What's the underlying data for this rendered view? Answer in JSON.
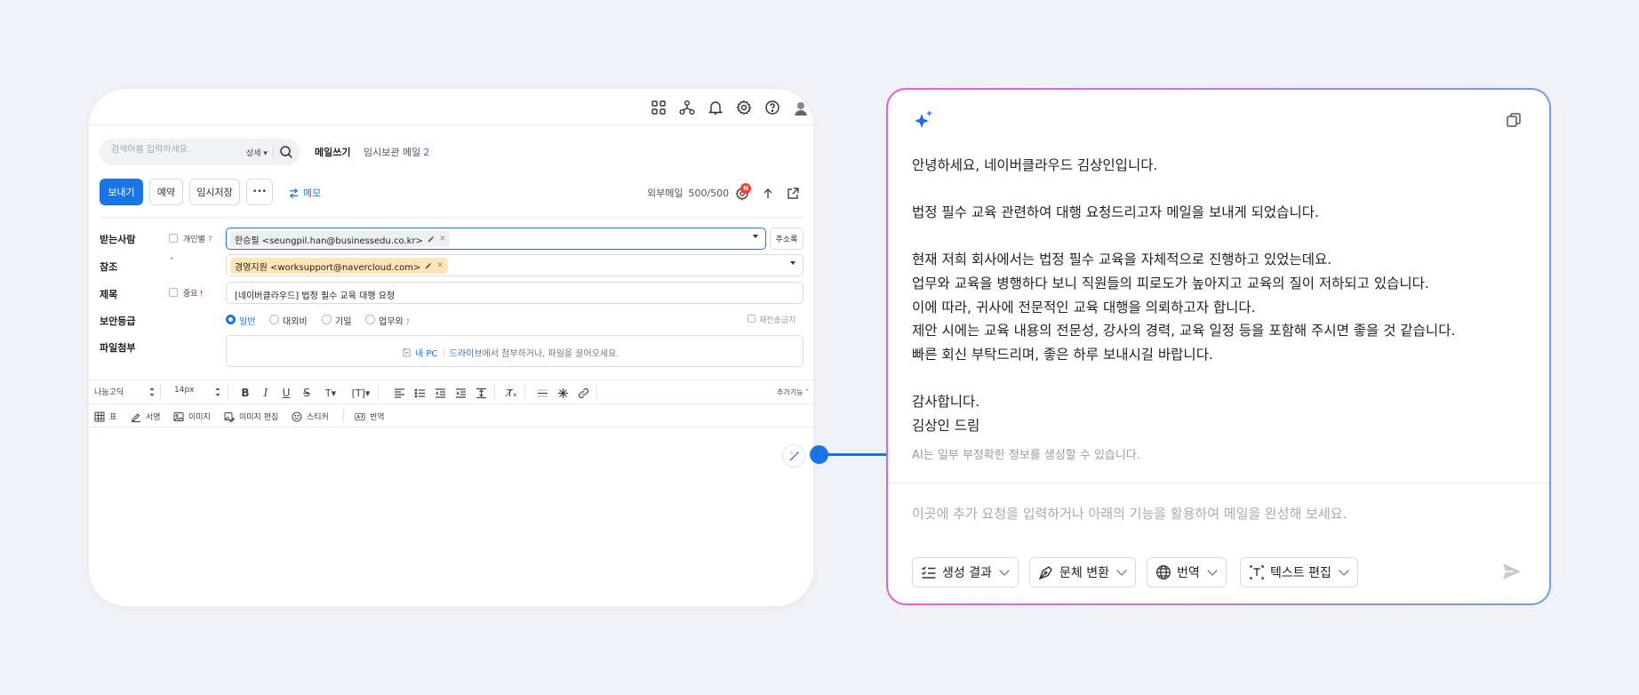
{
  "mail": {
    "search": {
      "placeholder": "검색어를 입력하세요.",
      "detail_label": "상세 ▾"
    },
    "tabs": {
      "compose": "메일쓰기",
      "drafts_label": "임시보관 메일",
      "drafts_count": "2"
    },
    "actions": {
      "send": "보내기",
      "schedule": "예약",
      "save_draft": "임시저장",
      "more": "•••",
      "memo": "메모"
    },
    "external": {
      "label": "외부메일",
      "count": "500/500",
      "badge": "N"
    },
    "fields": {
      "to_label": "받는사람",
      "individual_label": "개인별",
      "help": "?",
      "to_chip": "한승필 <seungpil.han@businessedu.co.kr>",
      "address_book": "주소록",
      "cc_label": "참조",
      "cc_chip": "경영지원 <worksupport@navercloud.com>",
      "subject_label": "제목",
      "important_label": "중요",
      "important_mark": "!",
      "subject_value": "[네이버클라우드] 법정 필수 교육 대행 요청",
      "security_label": "보안등급",
      "security_options": [
        "일반",
        "대외비",
        "기밀",
        "업무외"
      ],
      "security_selected": "일반",
      "no_forward": "재전송금지",
      "attach_label": "파일첨부",
      "attach_pc": "내 PC",
      "attach_drive": "드라이브",
      "attach_text": "에서 첨부하거나, 파일을 끌어오세요."
    },
    "editor": {
      "font": "나눔고딕",
      "size": "14px",
      "more_functions": "추가기능 ˄",
      "tools": [
        "표",
        "서명",
        "이미지",
        "이미지 편집",
        "스티커",
        "번역"
      ]
    }
  },
  "ai": {
    "letter": [
      "안녕하세요, 네이버클라우드 김상인입니다.",
      "",
      "법정 필수 교육 관련하여 대행 요청드리고자 메일을 보내게 되었습니다.",
      "",
      "현재 저희 회사에서는 법정 필수 교육을 자체적으로 진행하고 있었는데요.",
      "업무와 교육을 병행하다 보니 직원들의 피로도가 높아지고 교육의 질이 저하되고 있습니다.",
      "이에 따라, 귀사에 전문적인 교육 대행을 의뢰하고자 합니다.",
      "제안 시에는 교육 내용의 전문성, 강사의 경력, 교육 일정 등을 포함해 주시면 좋을 것 같습니다.",
      "빠른 회신 부탁드리며, 좋은 하루 보내시길 바랍니다.",
      "",
      "감사합니다.",
      "김상인 드림"
    ],
    "disclaimer": "AI는 일부 부정확한 정보를 생성할 수 있습니다.",
    "prompt_placeholder": "이곳에 추가 요청을 입력하거나 아래의 기능을 활용하여 메일을 완성해 보세요.",
    "pills": [
      "생성 결과",
      "문체 변환",
      "번역",
      "텍스트 편집"
    ]
  },
  "colors": {
    "accent": "#1b74e4",
    "ai_gradient_start": "#ee5bd2",
    "ai_gradient_end": "#6f9af5",
    "chip_highlight": "#fde5b6"
  }
}
